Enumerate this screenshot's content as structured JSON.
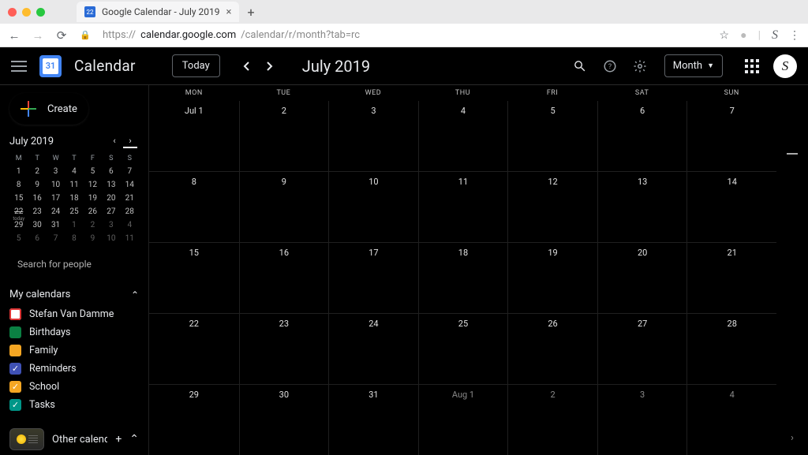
{
  "browser": {
    "tab_title": "Google Calendar - July 2019",
    "favicon_text": "22",
    "url_host": "calendar.google.com",
    "url_path": "/calendar/r/month?tab=rc",
    "url_prefix": "https://"
  },
  "header": {
    "logo_day": "31",
    "app_name": "Calendar",
    "today_label": "Today",
    "period_label": "July 2019",
    "view_label": "Month",
    "avatar_letter": "S"
  },
  "create_label": "Create",
  "mini_calendar": {
    "title": "July 2019",
    "weekday_abbr": [
      "M",
      "T",
      "W",
      "T",
      "F",
      "S",
      "S"
    ],
    "rows": [
      [
        {
          "n": "1"
        },
        {
          "n": "2"
        },
        {
          "n": "3"
        },
        {
          "n": "4"
        },
        {
          "n": "5"
        },
        {
          "n": "6"
        },
        {
          "n": "7"
        }
      ],
      [
        {
          "n": "8"
        },
        {
          "n": "9"
        },
        {
          "n": "10"
        },
        {
          "n": "11"
        },
        {
          "n": "12"
        },
        {
          "n": "13"
        },
        {
          "n": "14"
        }
      ],
      [
        {
          "n": "15"
        },
        {
          "n": "16"
        },
        {
          "n": "17"
        },
        {
          "n": "18"
        },
        {
          "n": "19"
        },
        {
          "n": "20"
        },
        {
          "n": "21"
        }
      ],
      [
        {
          "n": "22",
          "today": true
        },
        {
          "n": "23"
        },
        {
          "n": "24"
        },
        {
          "n": "25"
        },
        {
          "n": "26"
        },
        {
          "n": "27"
        },
        {
          "n": "28"
        }
      ],
      [
        {
          "n": "29"
        },
        {
          "n": "30"
        },
        {
          "n": "31"
        },
        {
          "n": "1",
          "other": true
        },
        {
          "n": "2",
          "other": true
        },
        {
          "n": "3",
          "other": true
        },
        {
          "n": "4",
          "other": true
        }
      ],
      [
        {
          "n": "5",
          "other": true
        },
        {
          "n": "6",
          "other": true
        },
        {
          "n": "7",
          "other": true
        },
        {
          "n": "8",
          "other": true
        },
        {
          "n": "9",
          "other": true
        },
        {
          "n": "10",
          "other": true
        },
        {
          "n": "11",
          "other": true
        }
      ]
    ]
  },
  "search_people_placeholder": "Search for people",
  "my_calendars": {
    "heading": "My calendars",
    "items": [
      {
        "label": "Stefan Van Damme",
        "color": "#ffffff",
        "check": false,
        "border": "#d33"
      },
      {
        "label": "Birthdays",
        "color": "#0b8043",
        "check": false
      },
      {
        "label": "Family",
        "color": "#f5a623",
        "check": false
      },
      {
        "label": "Reminders",
        "color": "#3f51b5",
        "check": true
      },
      {
        "label": "School",
        "color": "#f5a623",
        "check": true
      },
      {
        "label": "Tasks",
        "color": "#009688",
        "check": true
      }
    ]
  },
  "other_calendars_heading": "Other calendars",
  "grid": {
    "weekday_labels": [
      "MON",
      "TUE",
      "WED",
      "THU",
      "FRI",
      "SAT",
      "SUN"
    ],
    "weeks": [
      [
        "Jul 1",
        "2",
        "3",
        "4",
        "5",
        "6",
        "7"
      ],
      [
        "8",
        "9",
        "10",
        "11",
        "12",
        "13",
        "14"
      ],
      [
        "15",
        "16",
        "17",
        "18",
        "19",
        "20",
        "21"
      ],
      [
        "22",
        "23",
        "24",
        "25",
        "26",
        "27",
        "28"
      ],
      [
        "29",
        "30",
        "31",
        "Aug 1",
        "2",
        "3",
        "4"
      ]
    ],
    "other_month_row": 4,
    "other_month_from_col": 3
  }
}
